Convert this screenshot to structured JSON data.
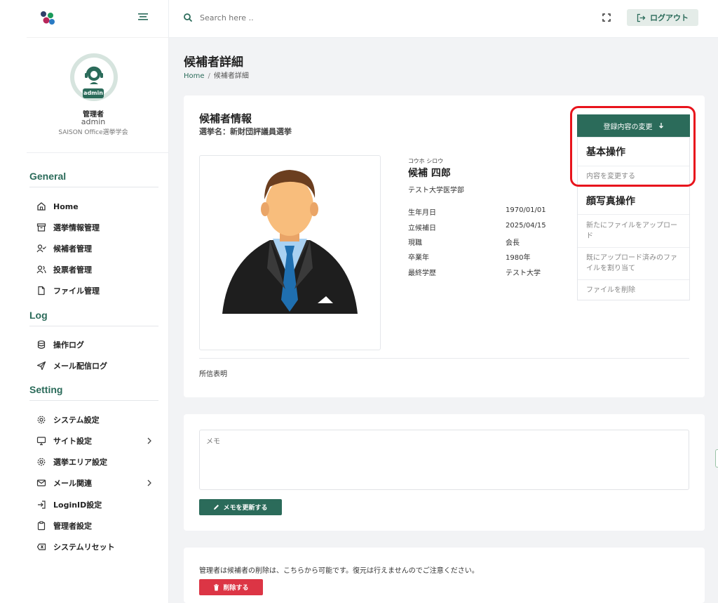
{
  "topbar": {
    "search_placeholder": "Search here ..",
    "logout_label": "ログアウト"
  },
  "profile": {
    "badge": "admin",
    "role": "管理者",
    "username": "admin",
    "organization": "SAISON Office選挙学会"
  },
  "sidebar": {
    "sections": {
      "general": "General",
      "log": "Log",
      "setting": "Setting"
    },
    "items": [
      {
        "label": "Home",
        "icon": "home-icon"
      },
      {
        "label": "選挙情報管理",
        "icon": "archive-icon"
      },
      {
        "label": "候補者管理",
        "icon": "user-check-icon"
      },
      {
        "label": "投票者管理",
        "icon": "users-icon"
      },
      {
        "label": "ファイル管理",
        "icon": "file-icon"
      },
      {
        "label": "操作ログ",
        "icon": "database-icon"
      },
      {
        "label": "メール配信ログ",
        "icon": "send-icon"
      },
      {
        "label": "システム設定",
        "icon": "gear-icon"
      },
      {
        "label": "サイト設定",
        "icon": "monitor-icon"
      },
      {
        "label": "選挙エリア設定",
        "icon": "gear-icon"
      },
      {
        "label": "メール関連",
        "icon": "mail-icon"
      },
      {
        "label": "LoginID設定",
        "icon": "login-icon"
      },
      {
        "label": "管理者設定",
        "icon": "clipboard-icon"
      },
      {
        "label": "システムリセット",
        "icon": "delete-box-icon"
      }
    ]
  },
  "page": {
    "title": "候補者詳細",
    "breadcrumb_home": "Home",
    "breadcrumb_sep": "/",
    "breadcrumb_current": "候補者詳細"
  },
  "candidate": {
    "section_title": "候補者情報",
    "election": "選挙名：新財団評議員選挙",
    "kana": "コウホ シロウ",
    "name": "候補 四郎",
    "university": "テスト大学医学部",
    "details": [
      {
        "label": "生年月日",
        "value": "1970/01/01"
      },
      {
        "label": "立候補日",
        "value": "2025/04/15"
      },
      {
        "label": "現職",
        "value": "会長"
      },
      {
        "label": "卒業年",
        "value": "1980年"
      },
      {
        "label": "最終学歴",
        "value": "テスト大学"
      }
    ],
    "statement_label": "所信表明"
  },
  "actions": {
    "change_button": "登録内容の変更",
    "basic_header": "基本操作",
    "basic_item": "内容を変更する",
    "photo_header": "顔写真操作",
    "photo_items": [
      "新たにファイルをアップロード",
      "既にアップロード済みのファイルを割り当て",
      "ファイルを削除"
    ]
  },
  "memo": {
    "placeholder": "メモ",
    "button": "メモを更新する"
  },
  "delete": {
    "note": "管理者は候補者の削除は、こちらから可能です。復元は行えませんのでご注意ください。",
    "button": "削除する"
  },
  "colors": {
    "accent": "#2b6b5a",
    "danger": "#dc3545",
    "highlight": "#e8141c"
  }
}
